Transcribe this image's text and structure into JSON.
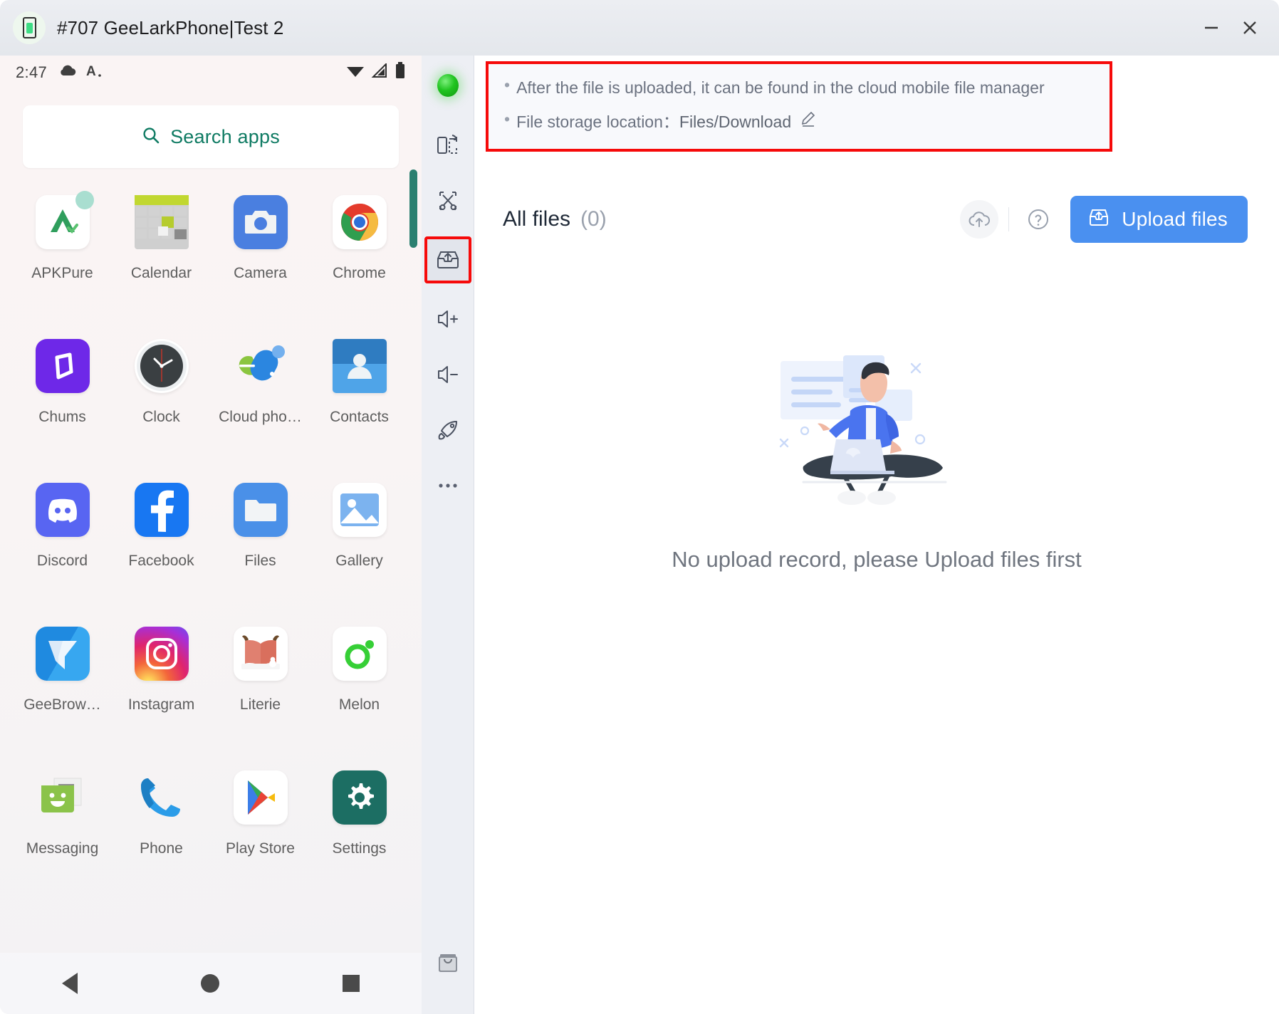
{
  "window": {
    "title": "#707 GeeLarkPhone|Test 2",
    "app_icon": "android-phone-icon",
    "minimize_label": "minimize-icon",
    "close_label": "close-icon"
  },
  "phone": {
    "status_bar": {
      "time": "2:47",
      "left_icons": [
        "cloud-icon",
        "font-size-icon"
      ],
      "right_icons": [
        "wifi-icon",
        "signal-icon",
        "battery-icon"
      ]
    },
    "search": {
      "placeholder": "Search apps",
      "icon": "search-icon"
    },
    "apps": [
      {
        "label": "APKPure",
        "icon": "apkpure-icon"
      },
      {
        "label": "Calendar",
        "icon": "calendar-icon"
      },
      {
        "label": "Camera",
        "icon": "camera-icon"
      },
      {
        "label": "Chrome",
        "icon": "chrome-icon"
      },
      {
        "label": "Chums",
        "icon": "chums-icon"
      },
      {
        "label": "Clock",
        "icon": "clock-icon"
      },
      {
        "label": "Cloud pho…",
        "icon": "cloud-phone-icon"
      },
      {
        "label": "Contacts",
        "icon": "contacts-icon"
      },
      {
        "label": "Discord",
        "icon": "discord-icon"
      },
      {
        "label": "Facebook",
        "icon": "facebook-icon"
      },
      {
        "label": "Files",
        "icon": "files-icon"
      },
      {
        "label": "Gallery",
        "icon": "gallery-icon"
      },
      {
        "label": "GeeBrow…",
        "icon": "geebrowser-icon"
      },
      {
        "label": "Instagram",
        "icon": "instagram-icon"
      },
      {
        "label": "Literie",
        "icon": "literie-icon"
      },
      {
        "label": "Melon",
        "icon": "melon-icon"
      },
      {
        "label": "Messaging",
        "icon": "messaging-icon"
      },
      {
        "label": "Phone",
        "icon": "phone-icon"
      },
      {
        "label": "Play Store",
        "icon": "play-store-icon"
      },
      {
        "label": "Settings",
        "icon": "settings-icon"
      }
    ],
    "nav": {
      "back": "back-icon",
      "home": "home-icon",
      "recents": "recents-icon"
    }
  },
  "rail": {
    "status_indicator": "connection-status-dot",
    "items": [
      {
        "name": "rotate-screen-icon"
      },
      {
        "name": "scissors-clipboard-icon"
      },
      {
        "name": "upload-tray-icon",
        "active": true
      },
      {
        "name": "volume-up-icon"
      },
      {
        "name": "volume-down-icon"
      },
      {
        "name": "boost-rocket-icon"
      },
      {
        "name": "more-options-icon"
      }
    ],
    "bottom_item": {
      "name": "shop-bag-icon"
    }
  },
  "notice": {
    "line1": "After the file is uploaded, it can be found in the cloud mobile file manager",
    "line2_label": "File storage location：",
    "line2_value": "Files/Download",
    "edit_icon": "pencil-edit-icon",
    "border_color": "#f60a0a"
  },
  "files_panel": {
    "title": "All files",
    "count": "(0)",
    "cloud_upload_icon": "cloud-upload-icon",
    "help_icon": "question-circle-icon",
    "upload_button": {
      "label": "Upload files",
      "icon": "upload-box-icon",
      "color": "#4a90f0"
    },
    "empty_state": {
      "illustration": "person-with-laptop-illustration",
      "message": "No upload record, please Upload files first"
    }
  }
}
